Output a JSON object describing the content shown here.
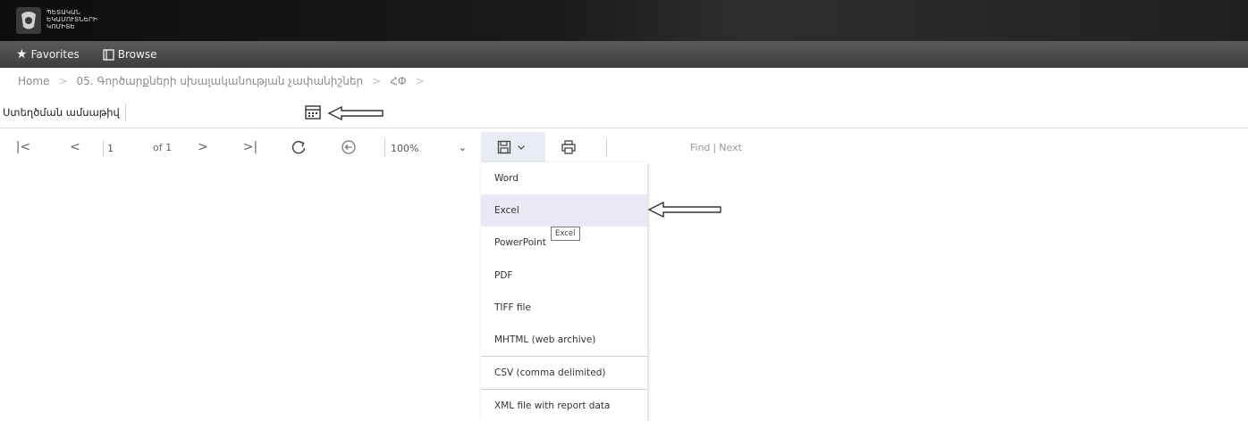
{
  "header": {
    "logo_lines": "ՊԵՏԱԿԱՆ\nԵԿԱՄՈՒՏՆԵՐԻ\nԿՈՄԻՏԵ"
  },
  "nav": {
    "favorites": "Favorites",
    "browse": "Browse"
  },
  "breadcrumb": {
    "home": "Home",
    "separator": ">",
    "folder": "05. Գործարքների սխալականության չափանիշներ",
    "current": "ՀՓ"
  },
  "params": {
    "label": "Ստեղծման ամսաթիվ",
    "value": ""
  },
  "toolbar": {
    "page_value": "1",
    "of_label": "of 1",
    "zoom": "100%",
    "find_label": "Find",
    "find_sep": "|",
    "next_label": "Next"
  },
  "export_menu": {
    "items": [
      "Word",
      "Excel",
      "PowerPoint",
      "PDF",
      "TIFF file",
      "MHTML (web archive)",
      "CSV (comma delimited)",
      "XML file with report data"
    ],
    "active_index": 1,
    "tooltip": "Excel"
  },
  "colors": {
    "topbar": "#1b1b1b",
    "navbar": "#4a4a4a",
    "menu_active": "#e8e9f5"
  }
}
